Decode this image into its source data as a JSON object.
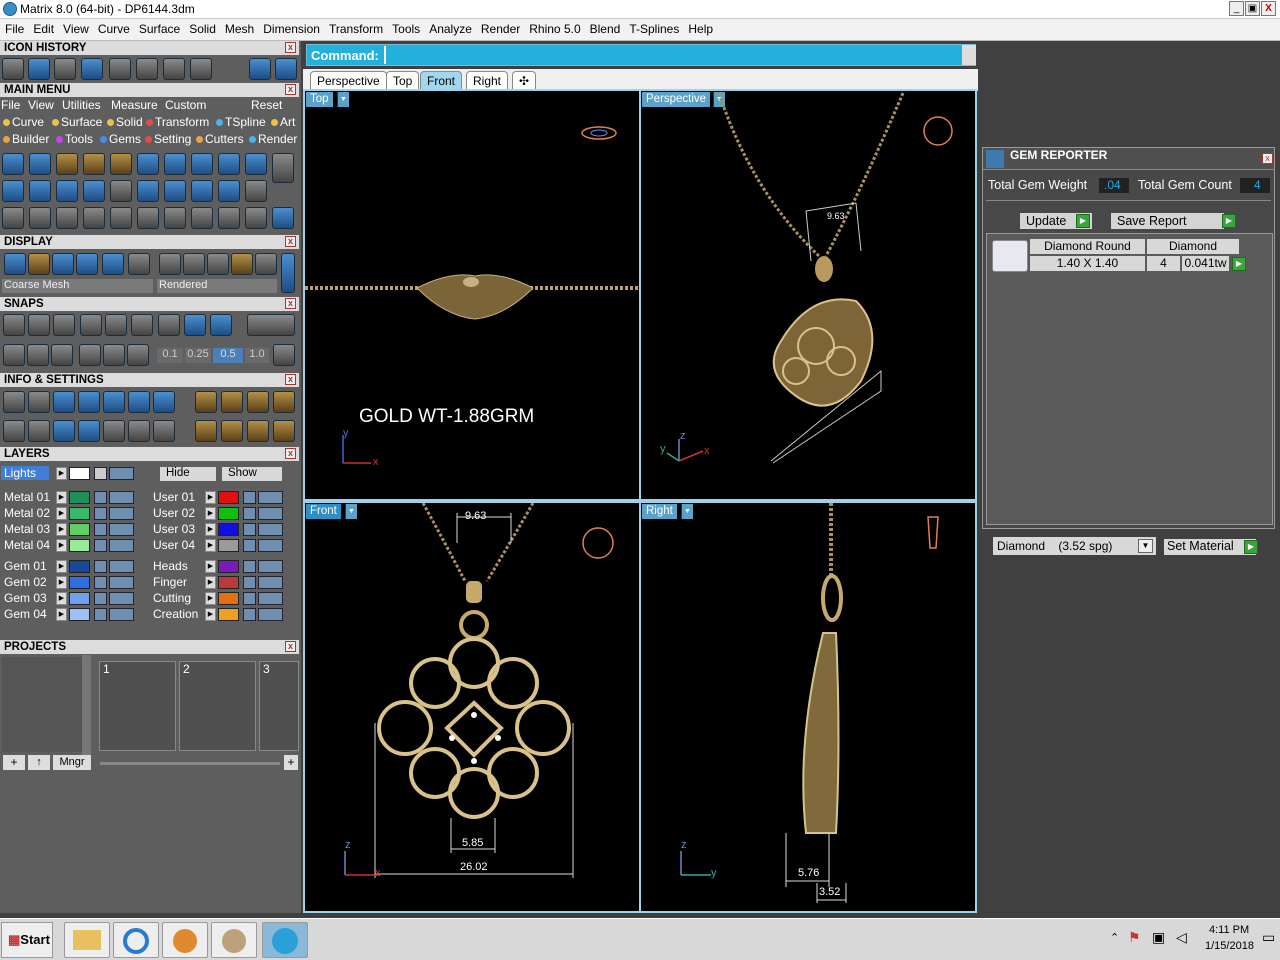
{
  "window": {
    "title": "Matrix 8.0 (64-bit) - DP6144.3dm",
    "min": "_",
    "max": "▣",
    "close": "X"
  },
  "menus": [
    "File",
    "Edit",
    "View",
    "Curve",
    "Surface",
    "Solid",
    "Mesh",
    "Dimension",
    "Transform",
    "Tools",
    "Analyze",
    "Render",
    "Rhino 5.0",
    "Blend",
    "T-Splines",
    "Help"
  ],
  "left": {
    "icon_history": "ICON HISTORY",
    "main_menu": "MAIN MENU",
    "main_menu_items": [
      "File",
      "View",
      "Utilities",
      "Measure",
      "Custom",
      "Reset"
    ],
    "row1": [
      "Curve",
      "Surface",
      "Solid",
      "Transform",
      "TSpline",
      "Art"
    ],
    "row2": [
      "Builder",
      "Tools",
      "Gems",
      "Setting",
      "Cutters",
      "Render"
    ],
    "display": "DISPLAY",
    "display_mesh": "Coarse Mesh",
    "display_mode": "Rendered",
    "snaps": "SNAPS",
    "snap_values": [
      "0.1",
      "0.25",
      "0.5",
      "1.0"
    ],
    "info": "INFO & SETTINGS",
    "layers": "LAYERS",
    "lights": "Lights",
    "hide": "Hide",
    "show": "Show",
    "layers_left": [
      "Metal 01",
      "Metal 02",
      "Metal 03",
      "Metal 04",
      "Gem 01",
      "Gem 02",
      "Gem 03",
      "Gem 04"
    ],
    "layers_right": [
      "User 01",
      "User 02",
      "User 03",
      "User 04",
      "Heads",
      "Finger",
      "Cutting",
      "Creation"
    ],
    "projects": "PROJECTS",
    "project_slots": [
      "1",
      "2",
      "3"
    ],
    "mngr": "Mngr"
  },
  "command": {
    "label": "Command:"
  },
  "tabs": [
    "Perspective",
    "Top",
    "Front",
    "Right"
  ],
  "active_tab": "Front",
  "viewports": {
    "top": {
      "label": "Top",
      "text": "GOLD WT-1.88GRM",
      "ax": "x",
      "ay": "y"
    },
    "perspective": {
      "label": "Perspective",
      "dim": "9.63",
      "ax": "x",
      "ay": "y",
      "az": "z"
    },
    "front": {
      "label": "Front",
      "dims": [
        "9.63",
        "5.85",
        "26.02"
      ],
      "ax": "x",
      "az": "z"
    },
    "right": {
      "label": "Right",
      "dims": [
        "5.76",
        "3.52"
      ],
      "ay": "y",
      "az": "z"
    }
  },
  "gem": {
    "title": "GEM REPORTER",
    "weight_label": "Total Gem Weight",
    "weight": ".04",
    "count_label": "Total Gem Count",
    "count": "4",
    "update": "Update",
    "save": "Save Report",
    "shape": "Diamond Round",
    "size": "1.40 X 1.40",
    "type": "Diamond",
    "qty": "4",
    "tw": "0.041tw",
    "material": "Diamond    (3.52 spg)",
    "set_material": "Set Material"
  },
  "taskbar": {
    "start": "Start",
    "time": "4:11 PM",
    "date": "1/15/2018"
  }
}
